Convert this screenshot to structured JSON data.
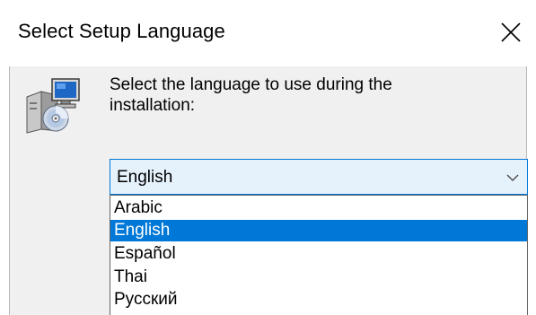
{
  "window": {
    "title": "Select Setup Language",
    "close_icon": "close-icon"
  },
  "dialog": {
    "icon": "setup-installer-icon",
    "prompt": "Select the language to use during the installation:"
  },
  "language_select": {
    "selected_value": "English",
    "chevron_icon": "chevron-down-icon",
    "options": [
      {
        "label": "Arabic",
        "selected": false
      },
      {
        "label": "English",
        "selected": true
      },
      {
        "label": "Español",
        "selected": false
      },
      {
        "label": "Thai",
        "selected": false
      },
      {
        "label": "Русский",
        "selected": false
      }
    ]
  },
  "colors": {
    "accent": "#0078d7",
    "combo_background": "#e5f1fb",
    "dialog_background": "#f0f0f0"
  }
}
